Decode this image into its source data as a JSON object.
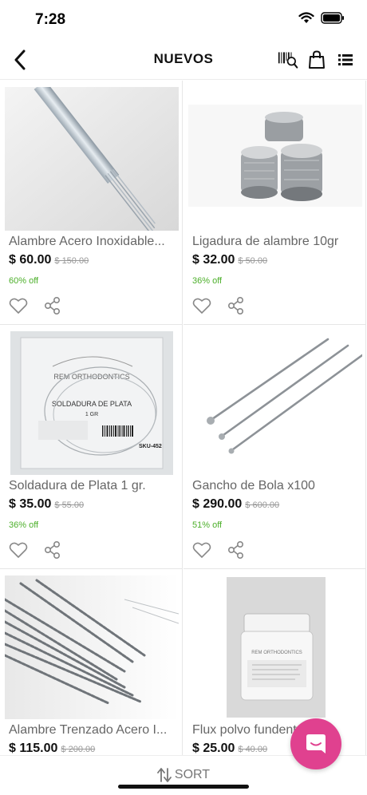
{
  "status_bar": {
    "time": "7:28"
  },
  "nav": {
    "title": "NUEVOS"
  },
  "products": [
    {
      "name": "Alambre Acero Inoxidable...",
      "price": "$ 60.00",
      "old_price": "$ 150.00",
      "discount": "60% off"
    },
    {
      "name": "Ligadura de alambre 10gr",
      "price": "$ 32.00",
      "old_price": "$ 50.00",
      "discount": "36% off"
    },
    {
      "name": "Soldadura de Plata 1 gr.",
      "price": "$ 35.00",
      "old_price": "$ 55.00",
      "discount": "36% off",
      "package": {
        "brand": "REM ORTHODONTICS",
        "label": "SOLDADURA DE PLATA",
        "qty": "1 GR",
        "sku": "SKU-452"
      }
    },
    {
      "name": "Gancho de Bola x100",
      "price": "$ 290.00",
      "old_price": "$ 600.00",
      "discount": "51% off"
    },
    {
      "name": "Alambre Trenzado Acero I...",
      "price": "$ 115.00",
      "old_price": "$ 200.00",
      "discount": ""
    },
    {
      "name": "Flux polvo fundente pa...",
      "price": "$ 25.00",
      "old_price": "$ 40.00",
      "discount": "",
      "jar": {
        "brand": "REM ORTHODONTICS"
      }
    }
  ],
  "bottom": {
    "sort_label": "SORT"
  },
  "colors": {
    "discount": "#4caf2a",
    "chat_fab": "#e0418f"
  },
  "icons": [
    "back-arrow-icon",
    "barcode-search-icon",
    "shopping-bag-icon",
    "list-view-icon",
    "heart-icon",
    "share-icon",
    "sort-icon",
    "chat-icon"
  ]
}
